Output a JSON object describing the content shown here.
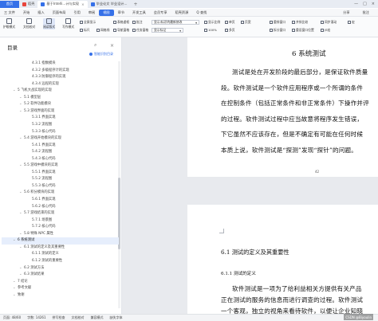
{
  "tabs": [
    {
      "label": "首页",
      "color": "#3570e8"
    },
    {
      "label": "稻壳",
      "color": "#e8453c"
    },
    {
      "label": "基于Intelli...计与实现",
      "color": "#3570e8"
    },
    {
      "label": "毕业论文 毕业设计...",
      "color": "#3570e8"
    }
  ],
  "menu": {
    "items": [
      "三 文件",
      "开始",
      "插入",
      "页面布局",
      "引用",
      "审阅",
      "视图",
      "章节",
      "开发工具",
      "会员专享",
      "稻壳资源"
    ],
    "active": "视图",
    "search": "Q 查找",
    "right": [
      "分享",
      "批注"
    ]
  },
  "toolbar": {
    "big": [
      {
        "label": "护眼模式"
      },
      {
        "label": "文档校对"
      },
      {
        "label": "阅读版式"
      },
      {
        "label": "写作模式"
      }
    ],
    "small_row1": [
      "全屏显示",
      "标尺",
      "网格线",
      "表格虚框",
      "导航窗格",
      "批注",
      "任务窗格"
    ],
    "small_row2": [
      "显示比例",
      "100%",
      "单页",
      "多页",
      "页宽"
    ],
    "combo1": "显示/标识的最新修改",
    "combo2": "显示标记",
    "right_row1": [
      "重排窗口",
      "并排比较",
      "同步滚动",
      "宏"
    ],
    "right_row2": [
      "拆分窗口",
      "重设窗口位置",
      "JS宏"
    ]
  },
  "nav": {
    "title": "目录",
    "smart": "智能识别目录",
    "items": [
      {
        "text": "4.3.1 指数模块",
        "level": 3
      },
      {
        "text": "4.3.2 多级程序计的实现",
        "level": 3
      },
      {
        "text": "4.3.3 防御程序的实现",
        "level": 3
      },
      {
        "text": "4.3.4 远程的实现",
        "level": 3
      },
      {
        "text": "5 飞机大战实现的实现",
        "level": 1
      },
      {
        "text": "5.1 模型层",
        "level": 2
      },
      {
        "text": "5.2 软件功能模块",
        "level": 2
      },
      {
        "text": "5.3 游戏界面的实现",
        "level": 2
      },
      {
        "text": "5.3.1 界面实现",
        "level": 3
      },
      {
        "text": "5.3.2 流程图",
        "level": 3
      },
      {
        "text": "5.3.3 核心代码",
        "level": 3
      },
      {
        "text": "5.4 游戏开始模块的实现",
        "level": 2
      },
      {
        "text": "5.4.1 界面实现",
        "level": 3
      },
      {
        "text": "5.4.2 流程图",
        "level": 3
      },
      {
        "text": "5.4.3 核心代码",
        "level": 3
      },
      {
        "text": "5.5 游戏中模块的实现",
        "level": 2
      },
      {
        "text": "5.5.1 界面实现",
        "level": 3
      },
      {
        "text": "5.5.2 流程图",
        "level": 3
      },
      {
        "text": "5.5.3 核心代码",
        "level": 3
      },
      {
        "text": "5.6 积分模块的实现",
        "level": 2
      },
      {
        "text": "5.6.1 界面实现",
        "level": 3
      },
      {
        "text": "5.6.2 核心代码",
        "level": 3
      },
      {
        "text": "5.7 游戏结束的实现",
        "level": 2
      },
      {
        "text": "5.7.1 场景图",
        "level": 3
      },
      {
        "text": "5.7.2 核心代码",
        "level": 3
      },
      {
        "text": "5.8 特殊 NPC 属性",
        "level": 2
      },
      {
        "text": "6 系统测试",
        "level": 1
      },
      {
        "text": "6.1 测试的定义及其重要性",
        "level": 2
      },
      {
        "text": "6.1.1 测试的定义",
        "level": 3
      },
      {
        "text": "6.1.2 测试的重要性",
        "level": 3
      },
      {
        "text": "6.2 测试方法",
        "level": 2
      },
      {
        "text": "6.3 测试结果",
        "level": 2
      },
      {
        "text": "7 结论",
        "level": 1
      },
      {
        "text": "参考文献",
        "level": 1
      },
      {
        "text": "致谢",
        "level": 1
      }
    ],
    "current_index": 26
  },
  "doc": {
    "page1": {
      "heading": "6    系统测试",
      "lines": [
        "测试是处在开发阶段的最后部分，是保证软件质量",
        "段。软件测试是一个软件应用程序或一个所谓的条件",
        "在控制条件（包括正常条件和非正常条件）下操作并评",
        "的过程。软件测试过程中应当故意将程序发生错误，",
        "下它虽然不应该存在，但是不确定有可能在任何时候",
        "本质上说，软件测试是“探测”发现“探针”的问题。"
      ],
      "page_number": "42"
    },
    "page2": {
      "h2": "6.1  测试的定义及其重要性",
      "h3": "6.1.1  测试的定义",
      "lines": [
        "软件测试是一项为了给利益相关方提供有关产品",
        "正在测试的服务的信息而进行调查的过程。软件测试",
        "一个客观，独立的视角来看待软件，以便让企业知晓"
      ]
    }
  },
  "status": {
    "page": "页面: 48/60",
    "words": "字数: 14261",
    "spell": "拼写检查",
    "proof": "文档校对",
    "compat": "兼容模式",
    "font_missing": "缺失字体"
  },
  "watermark": "CSDN @Biyoulin"
}
